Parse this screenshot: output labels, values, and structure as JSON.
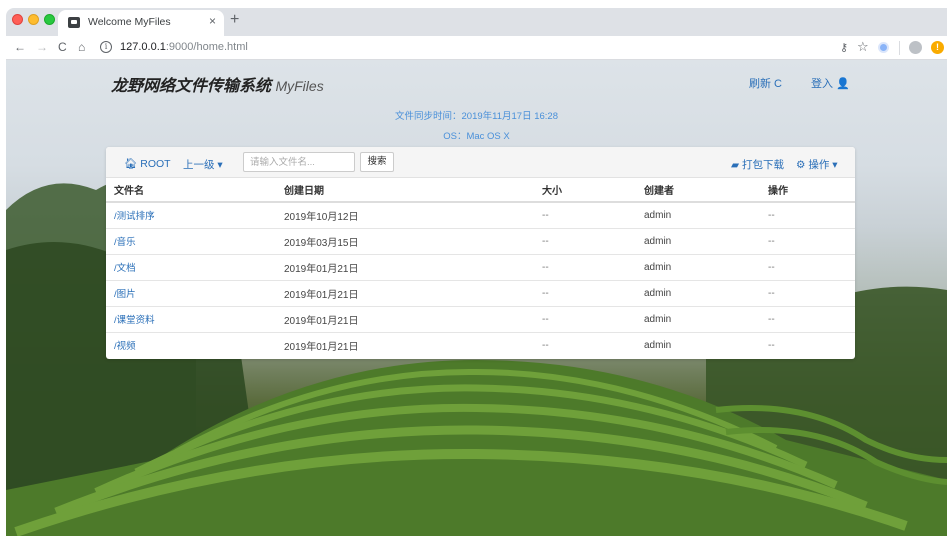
{
  "browser": {
    "tab_title": "Welcome MyFiles",
    "tab_close": "×",
    "new_tab": "+",
    "url_host": "127.0.0.1",
    "url_path": ":9000/home.html",
    "nav": {
      "back": "←",
      "forward": "→",
      "reload": "C",
      "home": "⌂"
    },
    "info_icon": "i"
  },
  "header": {
    "brand": "龙野网络文件传输系统",
    "brand_sub": "MyFiles",
    "refresh_label": "刷新 C",
    "login_label": "登入 👤"
  },
  "info": {
    "sync_time": "文件同步时间：2019年11月17日 16:28",
    "os": "OS：Mac OS X"
  },
  "toolbar": {
    "root_label": "ROOT",
    "up_label": "上一级 ▾",
    "search_placeholder": "请输入文件名...",
    "search_button": "搜索",
    "zip_label": "打包下载",
    "ops_label": "操作 ▾"
  },
  "table": {
    "columns": [
      "文件名",
      "创建日期",
      "大小",
      "创建者",
      "操作"
    ],
    "rows": [
      {
        "name": "/测试排序",
        "date": "2019年10月12日",
        "size": "--",
        "owner": "admin",
        "action": "--"
      },
      {
        "name": "/音乐",
        "date": "2019年03月15日",
        "size": "--",
        "owner": "admin",
        "action": "--"
      },
      {
        "name": "/文档",
        "date": "2019年01月21日",
        "size": "--",
        "owner": "admin",
        "action": "--"
      },
      {
        "name": "/图片",
        "date": "2019年01月21日",
        "size": "--",
        "owner": "admin",
        "action": "--"
      },
      {
        "name": "/课堂资料",
        "date": "2019年01月21日",
        "size": "--",
        "owner": "admin",
        "action": "--"
      },
      {
        "name": "/视频",
        "date": "2019年01月21日",
        "size": "--",
        "owner": "admin",
        "action": "--"
      }
    ]
  },
  "colors": {
    "link": "#2a6fb8",
    "info_text": "#4a90d9"
  }
}
